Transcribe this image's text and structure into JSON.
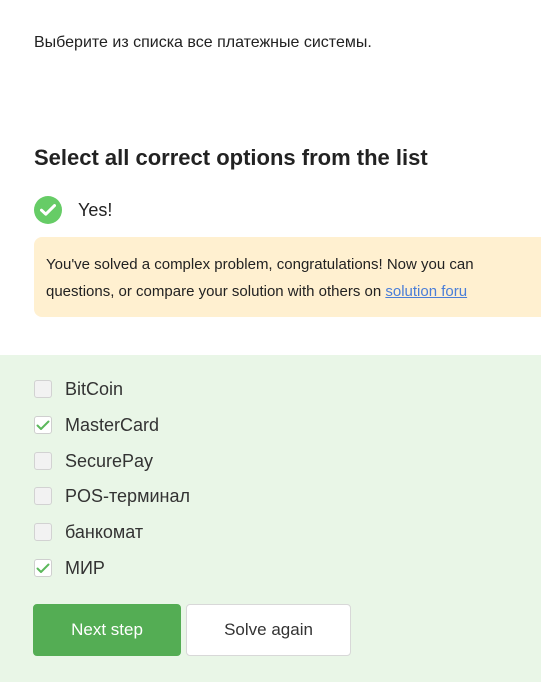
{
  "question": {
    "text": "Выберите из списка все платежные системы."
  },
  "section": {
    "title": "Select all correct options from the list"
  },
  "result": {
    "label": "Yes!",
    "icon": "check-circle-icon",
    "color": "#66cc66"
  },
  "hint": {
    "line1": "You've solved a complex problem, congratulations! Now you can",
    "line2_prefix": "questions, or compare your solution with others on ",
    "link_text": "solution foru",
    "background": "#fff0d0"
  },
  "options": [
    {
      "label": "BitCoin",
      "checked": false
    },
    {
      "label": "MasterCard",
      "checked": true
    },
    {
      "label": "SecurePay",
      "checked": false
    },
    {
      "label": "POS-терминал",
      "checked": false
    },
    {
      "label": "банкомат",
      "checked": false
    },
    {
      "label": "МИР",
      "checked": true
    }
  ],
  "buttons": {
    "next_label": "Next step",
    "solve_again_label": "Solve again",
    "primary_color": "#54ad54"
  },
  "colors": {
    "answer_area_bg": "#e9f6e7",
    "link": "#4a7ed8"
  }
}
